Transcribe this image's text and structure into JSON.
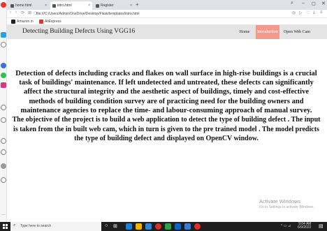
{
  "browser": {
    "tabs": [
      {
        "label": "home.html"
      },
      {
        "label": "intro.html"
      },
      {
        "label": "Register"
      }
    ],
    "new_tab": "+",
    "close": "×",
    "url": "file:///C:/Users/Admin/OneDrive/Desktop/Flask/templates/intro.html",
    "bookmarks": [
      {
        "label": "Amazon.in",
        "color": "#222222"
      },
      {
        "label": "AliExpress",
        "color": "#e43225"
      }
    ]
  },
  "site": {
    "title": "Detecting Building Defects Using VGG16",
    "nav": [
      {
        "label": "Home"
      },
      {
        "label": "Introduction",
        "active": true
      },
      {
        "label": "Open Web Cam"
      }
    ],
    "accent": "#f29b8c"
  },
  "content": {
    "para1": "Detection of defects including cracks and flakes on wall surface in high-rise buildings is a crucial task of buildings' maintenance. If left undetected and untreated, these defects can significantly affect the structural integrity and the aesthetic aspect of buildings, timely and cost-effective methods of building condition survey are of practicing need for the building owners and maintenance agencies to replace the time- and labour-consuming approach of manual survey.",
    "para2": "The objective of the project is to build a web application to detect the type of building defect . The input is taken from the in built web cam, which in turn is given to the pre trained model . The model predicts the type of building defect and displayed on OpenCV window."
  },
  "watermark": {
    "title": "Activate Windows",
    "subtitle": "Go to Settings to activate Windows."
  },
  "taskbar": {
    "search_placeholder": "Type here to search",
    "time": "9:04 AM",
    "date": "6/9/2022"
  }
}
